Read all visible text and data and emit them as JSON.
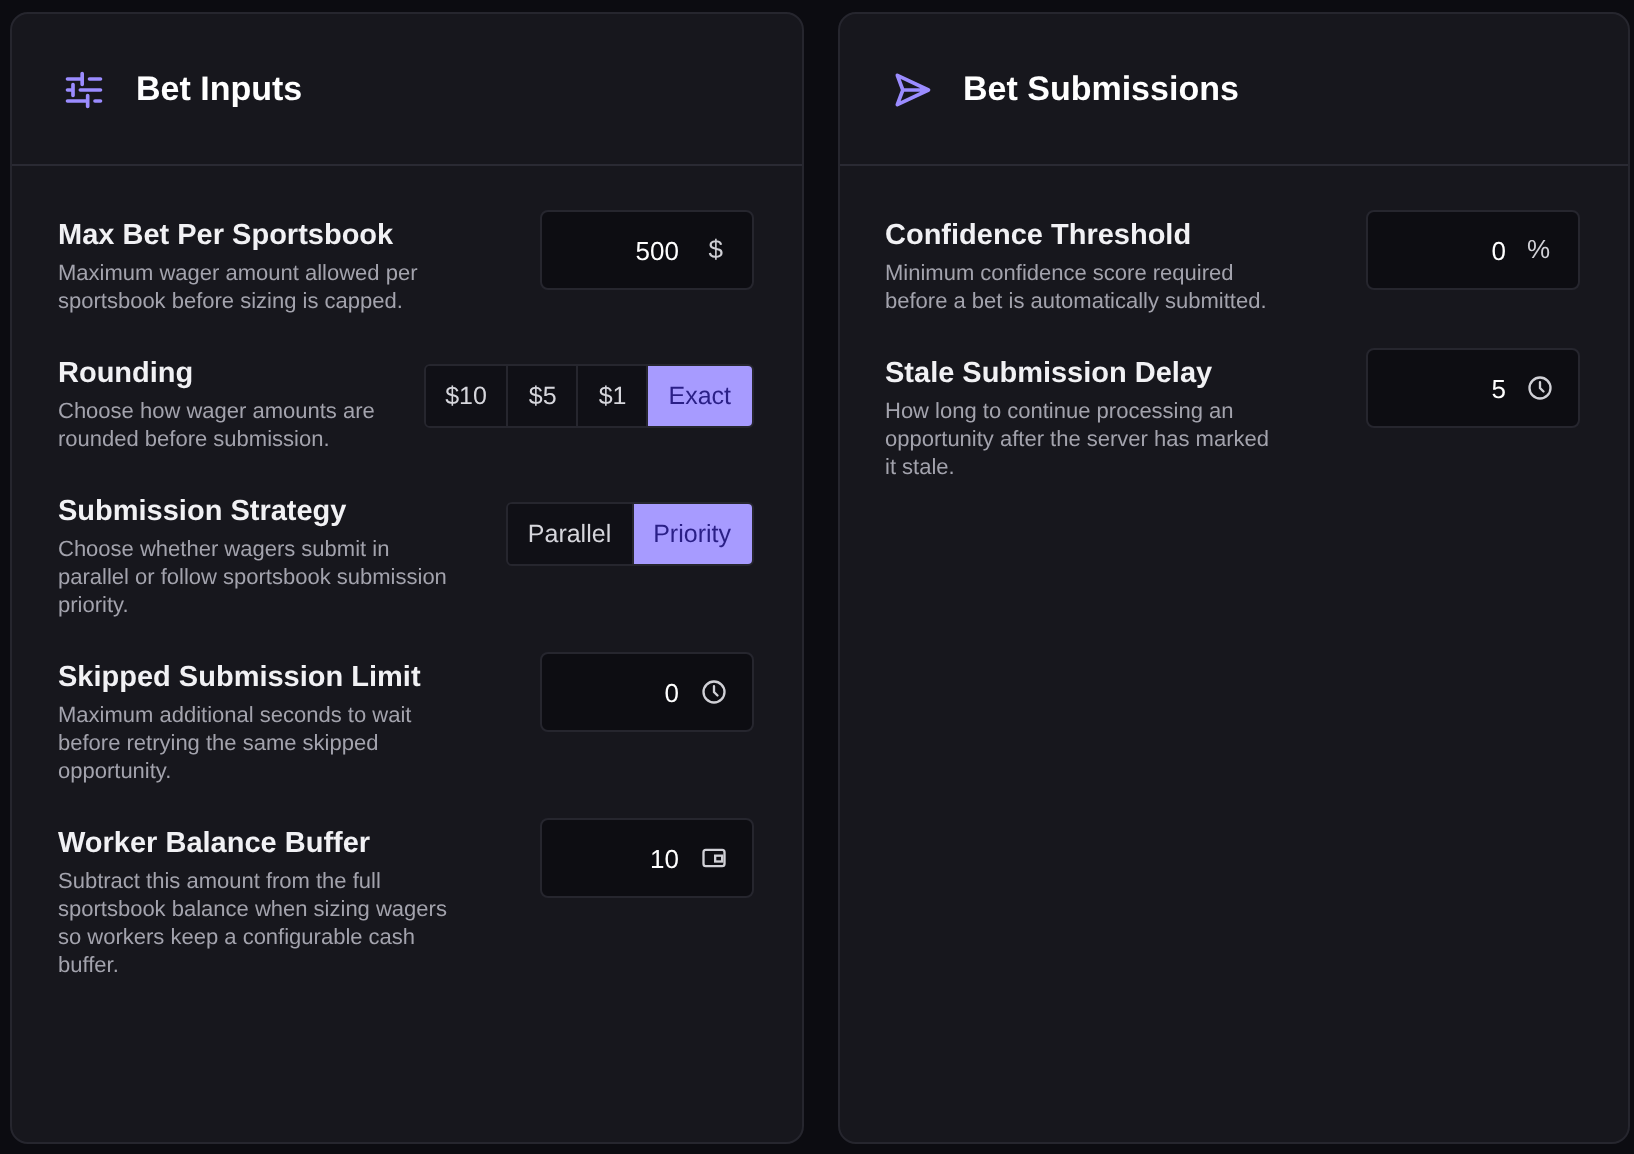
{
  "panels": [
    {
      "title": "Bet Inputs",
      "settings": [
        {
          "kind": "input",
          "label": "Max Bet Per Sportsbook",
          "description": "Maximum wager amount allowed per sportsbook before sizing is capped.",
          "value": "500",
          "unit": "$"
        },
        {
          "kind": "segmented",
          "label": "Rounding",
          "description": "Choose how wager amounts are rounded before submission.",
          "options": [
            {
              "label": "$10",
              "selected": false
            },
            {
              "label": "$5",
              "selected": false
            },
            {
              "label": "$1",
              "selected": false
            },
            {
              "label": "Exact",
              "selected": true
            }
          ]
        },
        {
          "kind": "segmented",
          "label": "Submission Strategy",
          "description": "Choose whether wagers submit in parallel or follow sportsbook submission priority.",
          "options": [
            {
              "label": "Parallel",
              "selected": false
            },
            {
              "label": "Priority",
              "selected": true
            }
          ]
        },
        {
          "kind": "duration",
          "label": "Skipped Submission Limit",
          "description": "Maximum additional seconds to wait before retrying the same skipped opportunity.",
          "value": "0"
        },
        {
          "kind": "balance",
          "label": "Worker Balance Buffer",
          "description": "Subtract this amount from the full sportsbook balance when sizing wagers so workers keep a configurable cash buffer.",
          "value": "10"
        }
      ]
    },
    {
      "title": "Bet Submissions",
      "settings": [
        {
          "kind": "input",
          "label": "Confidence Threshold",
          "description": "Minimum confidence score required before a bet is automatically submitted.",
          "value": "0",
          "unit": "%"
        },
        {
          "kind": "duration",
          "label": "Stale Submission Delay",
          "description": "How long to continue processing an opportunity after the server has marked it stale.",
          "value": "5"
        }
      ]
    }
  ]
}
